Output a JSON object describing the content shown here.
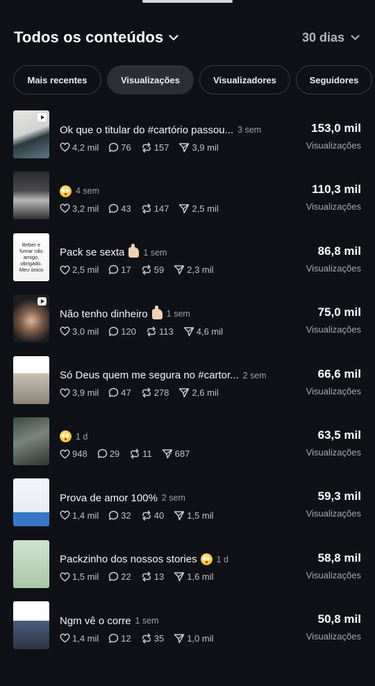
{
  "header": {
    "title": "Todos os conteúdos",
    "period": "30 dias"
  },
  "tabs": [
    {
      "label": "Mais recentes",
      "active": false
    },
    {
      "label": "Visualizações",
      "active": true
    },
    {
      "label": "Visualizadores",
      "active": false
    },
    {
      "label": "Seguidores",
      "active": false
    }
  ],
  "icons": {
    "likes": "heart-icon",
    "comments": "comment-icon",
    "reposts": "repost-icon",
    "shares": "share-icon",
    "chevron": "chevron-down-icon",
    "video": "play-icon"
  },
  "metric_label": "Visualizações",
  "posts": [
    {
      "caption": "Ok que o titular do #cartório passou...",
      "age": "3 sem",
      "likes": "4,2 mil",
      "comments": "76",
      "reposts": "157",
      "shares": "3,9 mil",
      "views": "153,0 mil"
    },
    {
      "caption": "",
      "emoji": "flushed-face",
      "age": "4 sem",
      "likes": "3,2 mil",
      "comments": "43",
      "reposts": "147",
      "shares": "2,5 mil",
      "views": "110,3 mil"
    },
    {
      "caption": "Pack se sexta",
      "emoji_after": "thumbs-up",
      "age": "1 sem",
      "likes": "2,5 mil",
      "comments": "17",
      "reposts": "59",
      "shares": "2,3 mil",
      "views": "86,8 mil",
      "thumb_text": "Beber e fumar não amigo, obrigado. Meu único vício é"
    },
    {
      "caption": "Não tenho dinheiro",
      "emoji_after": "thumbs-up",
      "age": "1 sem",
      "likes": "3,0 mil",
      "comments": "120",
      "reposts": "113",
      "shares": "4,6 mil",
      "views": "75,0 mil"
    },
    {
      "caption": "Só Deus quem me segura no #cartor...",
      "age": "2 sem",
      "likes": "3,9 mil",
      "comments": "47",
      "reposts": "278",
      "shares": "2,6 mil",
      "views": "66,6 mil"
    },
    {
      "caption": "",
      "emoji": "flushed-face",
      "age": "1 d",
      "likes": "948",
      "comments": "29",
      "reposts": "11",
      "shares": "687",
      "views": "63,5 mil"
    },
    {
      "caption": "Prova de amor 100%",
      "age": "2 sem",
      "likes": "1,4 mil",
      "comments": "32",
      "reposts": "40",
      "shares": "1,5 mil",
      "views": "59,3 mil"
    },
    {
      "caption": "Packzinho dos nossos stories",
      "emoji_after": "flushed-face",
      "age": "1 d",
      "likes": "1,5 mil",
      "comments": "22",
      "reposts": "13",
      "shares": "1,6 mil",
      "views": "58,8 mil"
    },
    {
      "caption": "Ngm vê o corre",
      "age": "1 sem",
      "likes": "1,4 mil",
      "comments": "12",
      "reposts": "35",
      "shares": "1,0 mil",
      "views": "50,8 mil"
    }
  ],
  "colors": {
    "background": "#0f1117",
    "text": "#f4f5f7",
    "muted": "#a5a8af",
    "chip_border": "#3b3e46",
    "chip_active": "#2b2e35"
  }
}
